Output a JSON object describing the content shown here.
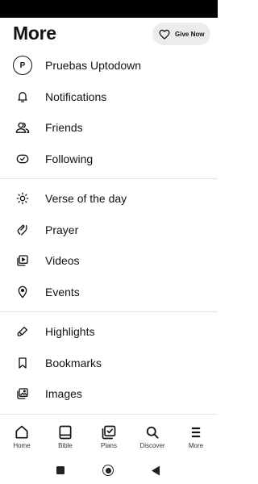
{
  "header": {
    "title": "More",
    "give_label": "Give Now"
  },
  "profile": {
    "initial": "P",
    "name": "Pruebas Uptodown"
  },
  "sections": {
    "notifications": "Notifications",
    "friends": "Friends",
    "following": "Following",
    "verse": "Verse of the day",
    "prayer": "Prayer",
    "videos": "Videos",
    "events": "Events",
    "highlights": "Highlights",
    "bookmarks": "Bookmarks",
    "images": "Images"
  },
  "bottom_nav": {
    "home": "Home",
    "bible": "Bible",
    "plans": "Plans",
    "discover": "Discover",
    "more": "More"
  }
}
